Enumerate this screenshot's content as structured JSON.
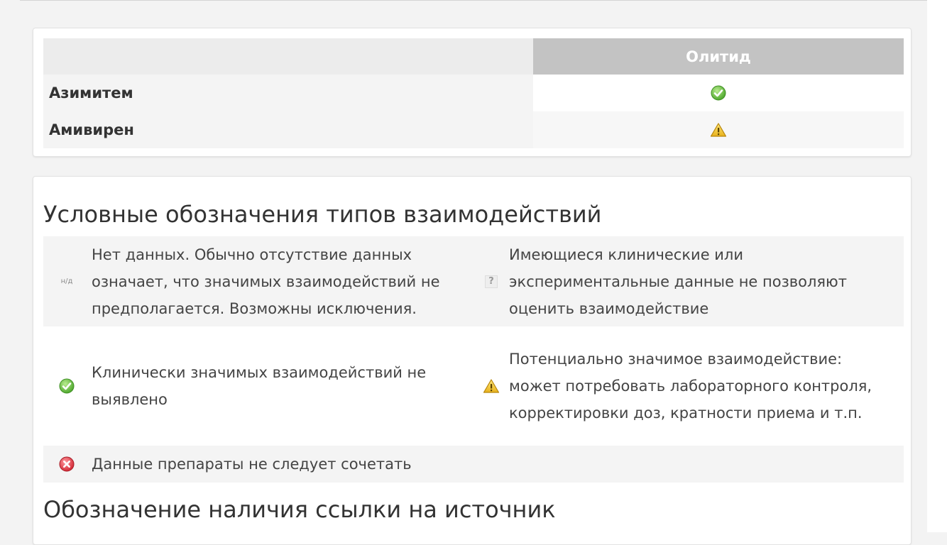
{
  "table": {
    "header": {
      "drug": "Олитид"
    },
    "rows": [
      {
        "name": "Азимитем",
        "status_icon": "check-icon"
      },
      {
        "name": "Амивирен",
        "status_icon": "warning-icon"
      }
    ]
  },
  "legend": {
    "title": "Условные обозначения типов взаимодействий",
    "items": [
      {
        "icon_label": "н/д",
        "text": "Нет данных. Обычно отсутствие данных означает, что значимых взаимодействий не предполагается. Возможны исключения."
      },
      {
        "icon_label": "?",
        "text": "Имеющиеся клинические или экспериментальные данные не позволяют оценить взаимодействие"
      },
      {
        "icon": "check-icon",
        "text": "Клинически значимых взаимодействий не выявлено"
      },
      {
        "icon": "warning-icon",
        "text": "Потенциально значимое взаимодействие: может потребовать лабораторного контроля, корректировки доз, кратности приема и т.п."
      },
      {
        "icon": "error-icon",
        "text": "Данные препараты не следует сочетать"
      }
    ]
  },
  "source_section": {
    "title": "Обозначение наличия ссылки на источник"
  },
  "colors": {
    "header_bg": "#c3c3c3",
    "check_green": "#6cc04a",
    "warning_yellow": "#f2c230",
    "error_red": "#e0454f"
  }
}
